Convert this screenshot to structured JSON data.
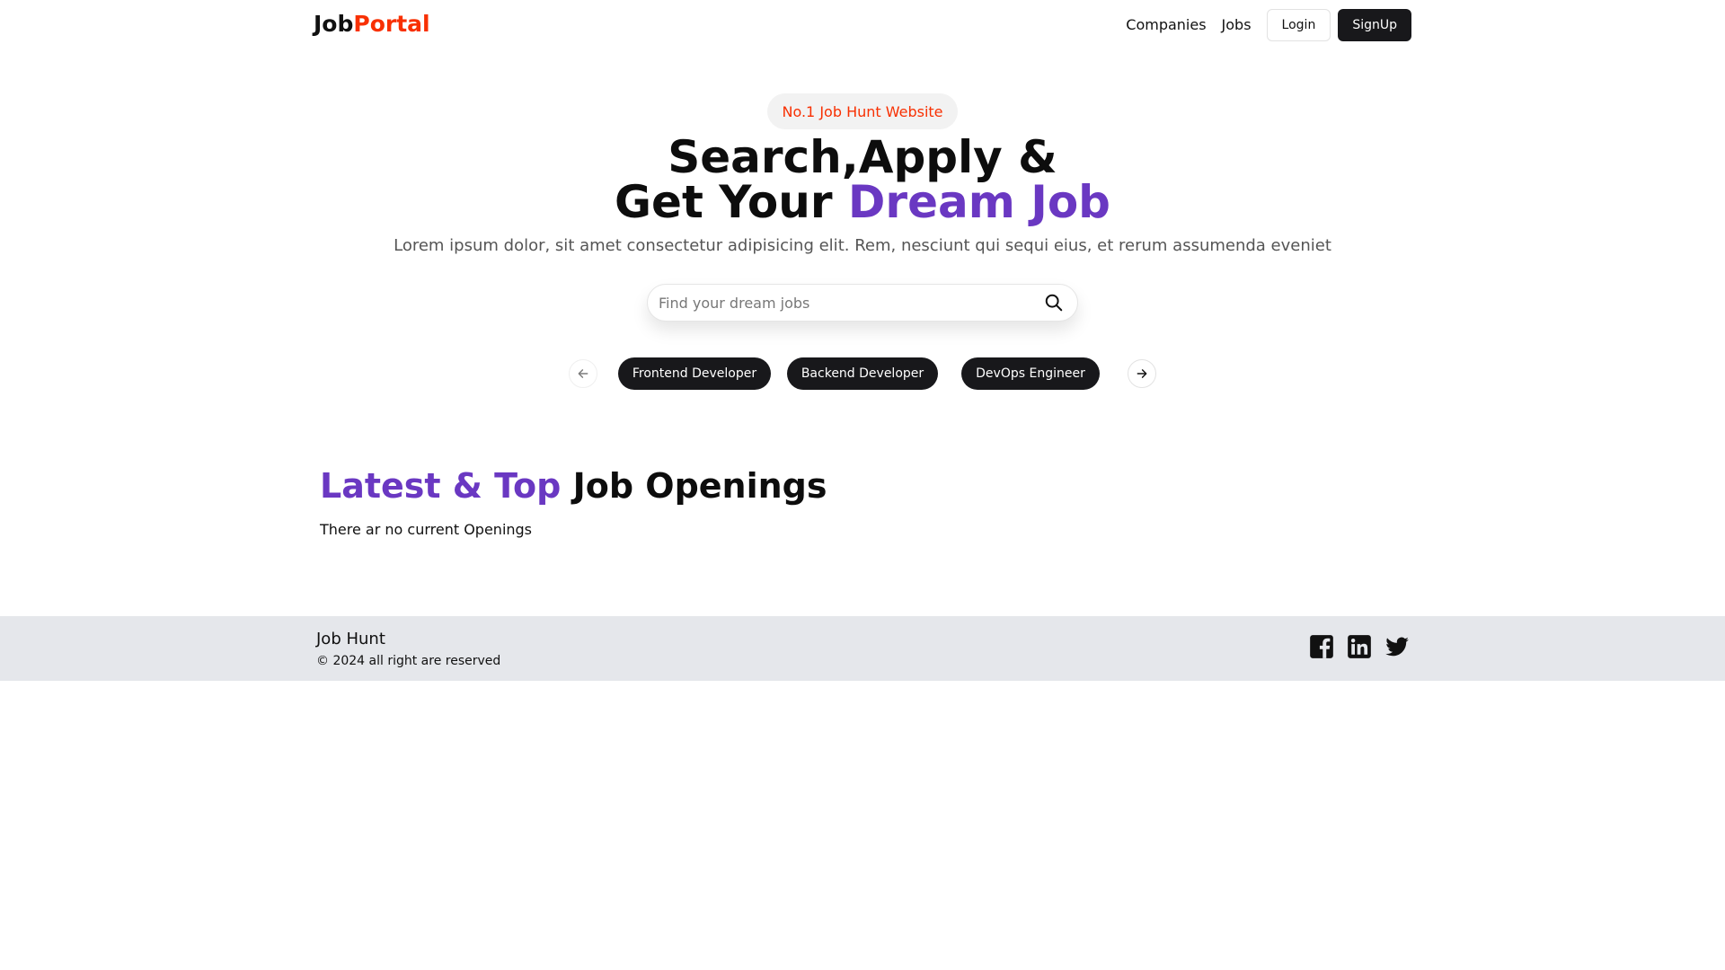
{
  "nav": {
    "logo_part1": "Job",
    "logo_part2": "Portal",
    "links": [
      "Companies",
      "Jobs"
    ],
    "login_label": "Login",
    "signup_label": "SignUp"
  },
  "hero": {
    "badge": "No.1 Job Hunt Website",
    "title_line1": "Search,Apply &",
    "title_line2_prefix": "Get Your ",
    "title_line2_accent": "Dream Job",
    "subtitle": "Lorem ipsum dolor, sit amet consectetur adipisicing elit. Rem, nesciunt qui sequi eius, et rerum assumenda eveniet",
    "search_placeholder": "Find your dream jobs"
  },
  "categories": [
    "Frontend Developer",
    "Backend Developer",
    "DevOps Engineer"
  ],
  "latest": {
    "title_accent": "Latest & Top",
    "title_rest": " Job Openings",
    "empty_message": "There ar no current Openings"
  },
  "footer": {
    "brand": "Job Hunt",
    "copyright": "© 2024 all right are reserved",
    "social_icons": [
      "facebook-icon",
      "linkedin-icon",
      "twitter-icon"
    ]
  },
  "colors": {
    "brand_red": "#f83002",
    "accent_purple": "#6a38c2",
    "dark": "#18181b",
    "footer_bg": "#e5e7eb"
  }
}
